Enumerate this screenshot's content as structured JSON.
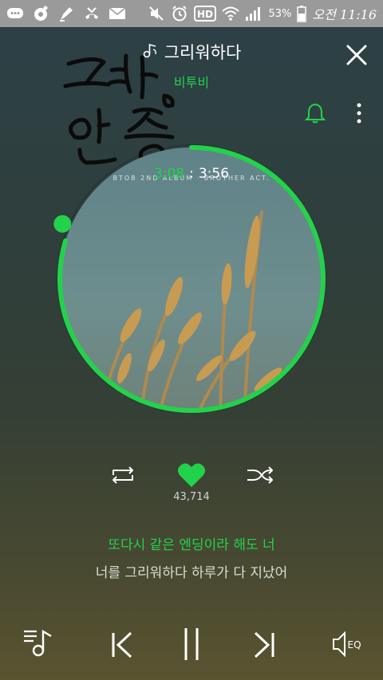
{
  "status_bar": {
    "battery_percent": "53%",
    "time": "오전 11:16",
    "hd_label": "HD",
    "icons": [
      "chat-icon",
      "media-icon",
      "pen-icon",
      "missed-call-icon",
      "mail-icon",
      "mute-icon",
      "alarm-icon",
      "hd-voice-icon",
      "wifi-icon",
      "signal-icon",
      "battery-icon"
    ]
  },
  "header": {
    "song_title": "그리워하다",
    "artist": "비투비"
  },
  "album": {
    "caption": "BTOB 2ND ALBUM · BROTHER ACT.",
    "elapsed": "3:08",
    "separator": ":",
    "duration": "3:56",
    "progress_fraction": 0.797,
    "accent_color": "#23d24b"
  },
  "controls": {
    "like_count": "43,714",
    "repeat": "repeat-icon",
    "like": "heart-icon",
    "shuffle": "shuffle-icon"
  },
  "lyrics": {
    "current": "또다시 같은 엔딩이라 해도 너",
    "next": "너를 그리워하다 하루가 다 지났어"
  },
  "bottom_bar": {
    "eq_label": "EQ",
    "icons": [
      "playlist-icon",
      "previous-icon",
      "pause-icon",
      "next-icon",
      "eq-icon"
    ]
  }
}
